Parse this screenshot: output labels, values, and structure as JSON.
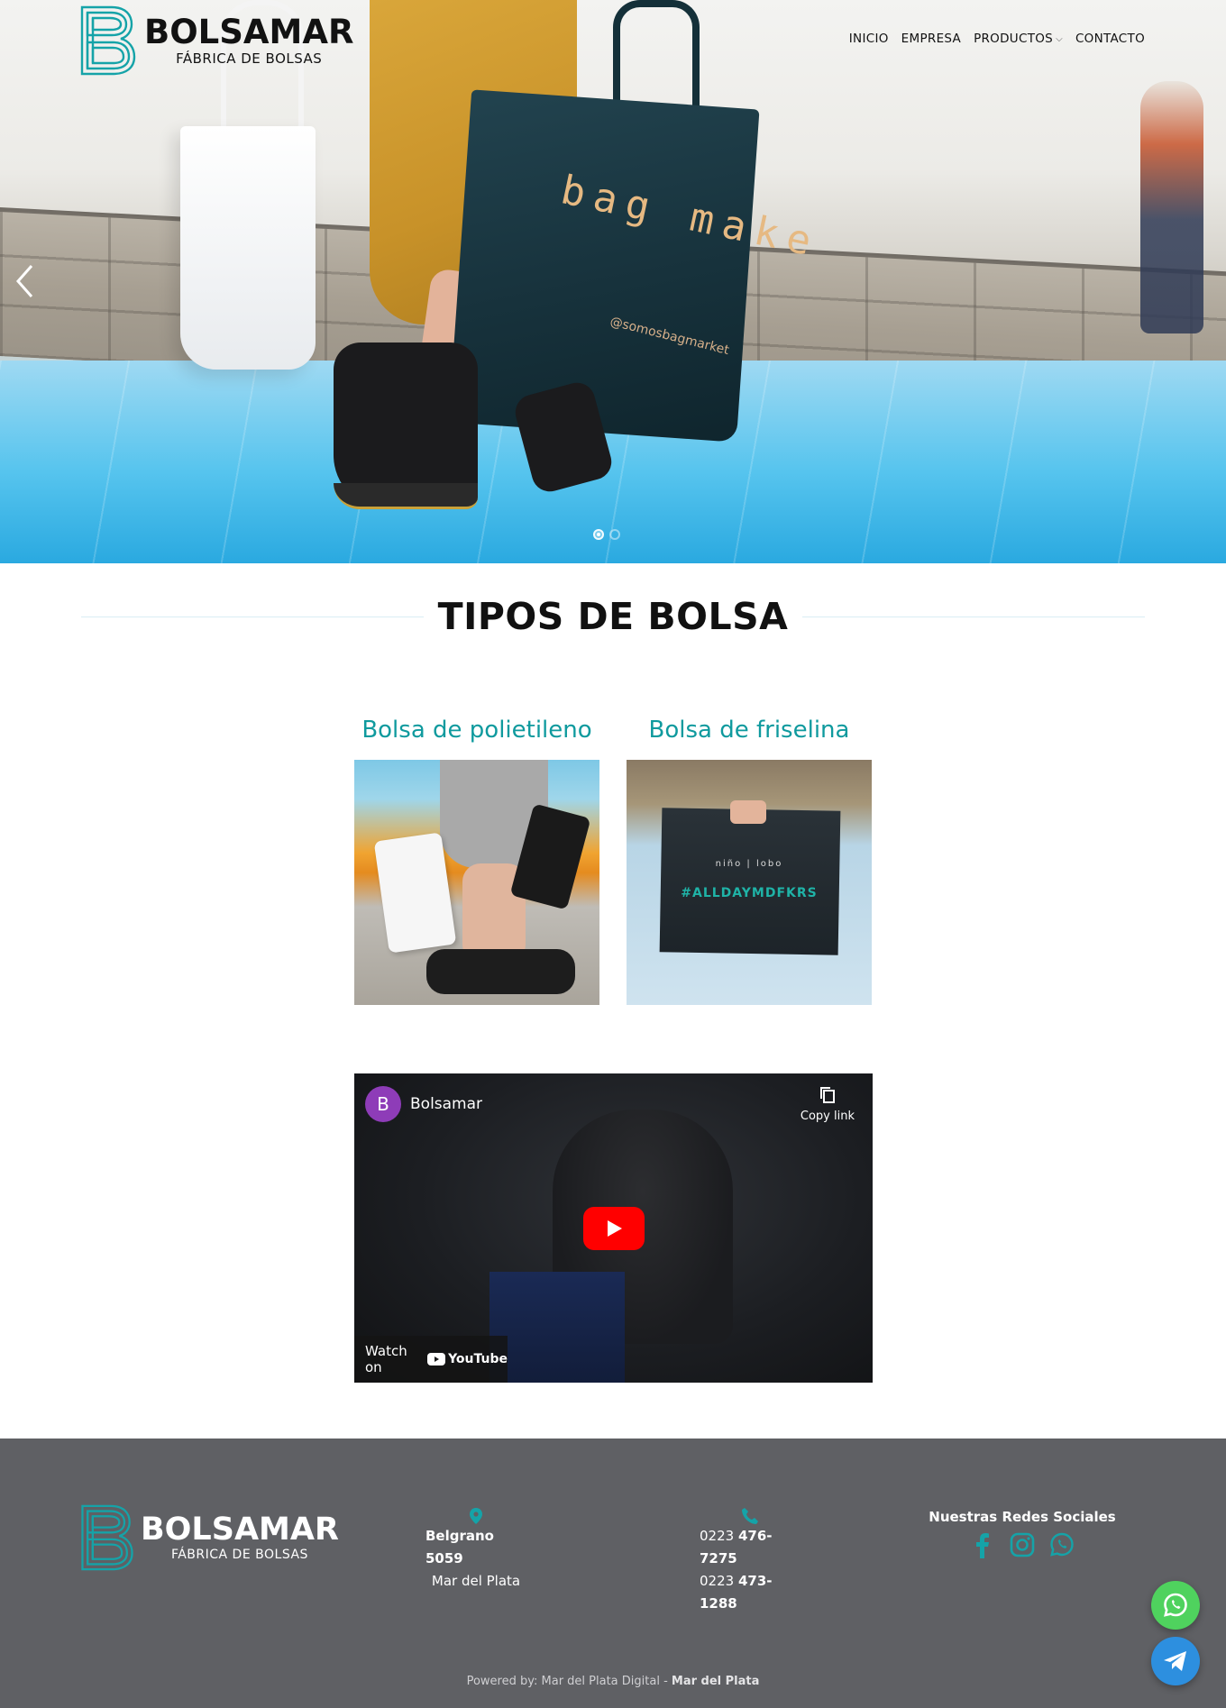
{
  "header": {
    "logo": {
      "brand": "BOLSAMAR",
      "tagline": "FÁBRICA DE BOLSAS"
    },
    "nav": [
      {
        "label": "INICIO"
      },
      {
        "label": "EMPRESA"
      },
      {
        "label": "PRODUCTOS",
        "has_dropdown": true
      },
      {
        "label": "CONTACTO"
      }
    ]
  },
  "hero": {
    "bag_print": "bag make",
    "bag_handle_text": "@somosbagmarket",
    "slides_count": 2,
    "active_slide": 1
  },
  "section": {
    "title": "TIPOS DE BOLSA",
    "cards": [
      {
        "title": "Bolsa de polietileno",
        "image": "woman-carrying-plastic-bags-photo"
      },
      {
        "title": "Bolsa de friselina",
        "image": "hand-holding-nonwoven-bag-photo",
        "bag_brand": "niño | lobo",
        "bag_text": "#ALLDAYMDFKRS"
      }
    ]
  },
  "video": {
    "avatar_letter": "B",
    "channel": "Bolsamar",
    "copy_link": "Copy link",
    "watch_on": "Watch on",
    "youtube": "YouTube"
  },
  "footer": {
    "logo": {
      "brand": "BOLSAMAR",
      "tagline": "FÁBRICA DE BOLSAS"
    },
    "address": {
      "line1": "Belgrano 5059",
      "line2": "Mar del Plata"
    },
    "phones": [
      {
        "prefix": "0223",
        "number": "476-7275"
      },
      {
        "prefix": "0223",
        "number": "473-1288"
      }
    ],
    "social_title": "Nuestras Redes Sociales",
    "powered_by": "Powered by: Mar del Plata Digital - ",
    "powered_city": "Mar del Plata"
  },
  "colors": {
    "accent": "#0f9a9e",
    "footer_bg": "#5f6064",
    "whatsapp": "#4fd25e",
    "telegram": "#2d8fdf",
    "youtube_red": "#ff0000"
  }
}
